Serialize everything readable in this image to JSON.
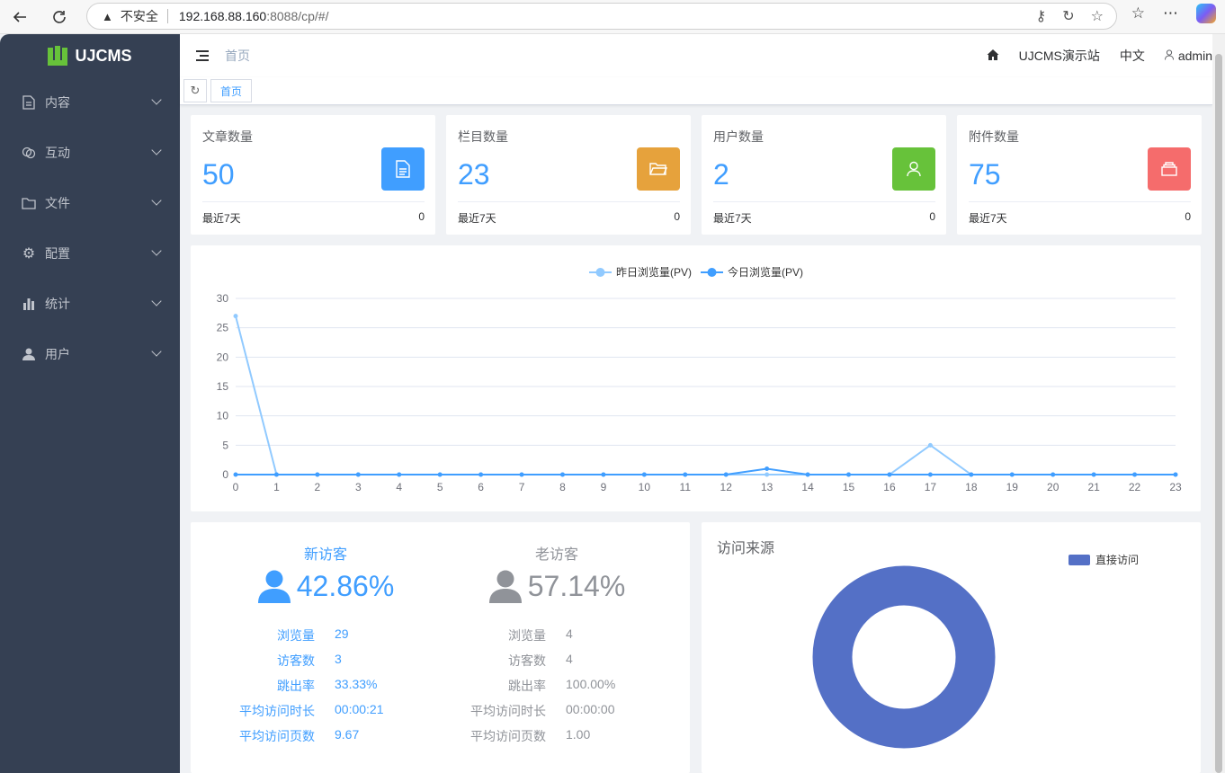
{
  "browser": {
    "insecure_label": "不安全",
    "url_host": "192.168.88.160",
    "url_path": ":8088/cp/#/"
  },
  "brand": {
    "name": "UJCMS",
    "logo_color": "#67c23a"
  },
  "sidebar": {
    "items": [
      {
        "label": "内容",
        "icon": "document-icon"
      },
      {
        "label": "互动",
        "icon": "chat-icon"
      },
      {
        "label": "文件",
        "icon": "folder-icon"
      },
      {
        "label": "配置",
        "icon": "gear-icon"
      },
      {
        "label": "统计",
        "icon": "bar-chart-icon"
      },
      {
        "label": "用户",
        "icon": "user-icon"
      }
    ]
  },
  "header": {
    "breadcrumb": "首页",
    "site_name": "UJCMS演示站",
    "language": "中文",
    "username": "admin"
  },
  "tabs": {
    "home": "首页"
  },
  "stats": [
    {
      "title": "文章数量",
      "value": "50",
      "footer": "最近7天",
      "footer_value": "0",
      "color": "#409eff",
      "icon": "document-icon"
    },
    {
      "title": "栏目数量",
      "value": "23",
      "footer": "最近7天",
      "footer_value": "0",
      "color": "#e6a23c",
      "icon": "folder-icon"
    },
    {
      "title": "用户数量",
      "value": "2",
      "footer": "最近7天",
      "footer_value": "0",
      "color": "#67c23a",
      "icon": "user-icon"
    },
    {
      "title": "附件数量",
      "value": "75",
      "footer": "最近7天",
      "footer_value": "0",
      "color": "#f56c6c",
      "icon": "attachment-icon"
    }
  ],
  "chart_data": {
    "type": "line",
    "x": [
      0,
      1,
      2,
      3,
      4,
      5,
      6,
      7,
      8,
      9,
      10,
      11,
      12,
      13,
      14,
      15,
      16,
      17,
      18,
      19,
      20,
      21,
      22,
      23
    ],
    "ylim": [
      0,
      30
    ],
    "yticks": [
      0,
      5,
      10,
      15,
      20,
      25,
      30
    ],
    "grid": true,
    "legend": "top-center",
    "series": [
      {
        "name": "昨日浏览量(PV)",
        "color": "#91caff",
        "values": [
          27,
          0,
          0,
          0,
          0,
          0,
          0,
          0,
          0,
          0,
          0,
          0,
          0,
          0,
          0,
          0,
          0,
          5,
          0,
          0,
          0,
          0,
          0,
          0
        ]
      },
      {
        "name": "今日浏览量(PV)",
        "color": "#409eff",
        "values": [
          0,
          0,
          0,
          0,
          0,
          0,
          0,
          0,
          0,
          0,
          0,
          0,
          0,
          1,
          0,
          0,
          0,
          0,
          0,
          0,
          0,
          0,
          0,
          0
        ]
      }
    ]
  },
  "visitors": {
    "new": {
      "title": "新访客",
      "percent": "42.86%",
      "rows": [
        {
          "k": "浏览量",
          "v": "29"
        },
        {
          "k": "访客数",
          "v": "3"
        },
        {
          "k": "跳出率",
          "v": "33.33%"
        },
        {
          "k": "平均访问时长",
          "v": "00:00:21"
        },
        {
          "k": "平均访问页数",
          "v": "9.67"
        }
      ]
    },
    "old": {
      "title": "老访客",
      "percent": "57.14%",
      "rows": [
        {
          "k": "浏览量",
          "v": "4"
        },
        {
          "k": "访客数",
          "v": "4"
        },
        {
          "k": "跳出率",
          "v": "100.00%"
        },
        {
          "k": "平均访问时长",
          "v": "00:00:00"
        },
        {
          "k": "平均访问页数",
          "v": "1.00"
        }
      ]
    }
  },
  "source": {
    "title": "访问来源",
    "legend": "直接访问",
    "color": "#5470c6",
    "share": 1.0
  }
}
